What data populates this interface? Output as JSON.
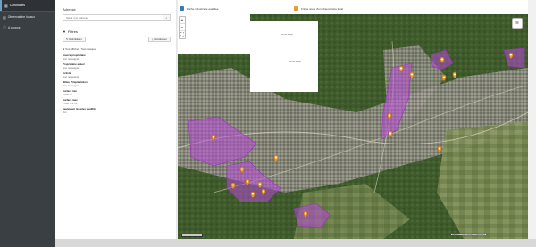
{
  "nav": {
    "items": [
      {
        "label": "Cartofiches",
        "icon": "map-icon",
        "active": true
      },
      {
        "label": "Observatoire locaux",
        "icon": "table-icon",
        "active": false
      },
      {
        "label": "A propos",
        "icon": "info-icon",
        "active": false
      }
    ]
  },
  "panel": {
    "address_label": "Adresse",
    "search_placeholder": "Saisir une adresse",
    "filters_title": "Filtres",
    "reset_label": "Réinitialiser",
    "export_label": "Réinitialiser",
    "show_all_label": "Tout afficher / Tout masquer",
    "filters": [
      {
        "label": "Source propriétaire",
        "value": "Non renseigné"
      },
      {
        "label": "Propriétaire actuel",
        "value": "Non renseigné"
      },
      {
        "label": "Activité",
        "value": "Non renseigné"
      },
      {
        "label": "Milieu d'implantation",
        "value": "Non renseigné"
      },
      {
        "label": "Surface min",
        "value": "0 000 m²"
      },
      {
        "label": "Surface max",
        "value": "1 000 772 m²"
      },
      {
        "label": "Seulement les sites qualifiés",
        "value": "Oui"
      }
    ]
  },
  "legend": {
    "item1": "Friche industrielle qualifiée",
    "item2": "Friche issue d'un observatoire local"
  },
  "map": {
    "zoom_in": "+",
    "zoom_out": "−",
    "fullscreen": "⛶",
    "attribution": "Leaflet | © IGN, Données Cartofriches",
    "watermark_a": "Aucune image",
    "watermark_b": "Aucune image"
  },
  "colors": {
    "nav_bg": "#3a3f44",
    "polygon": "#b84ad8",
    "marker": "#e89a2e"
  }
}
